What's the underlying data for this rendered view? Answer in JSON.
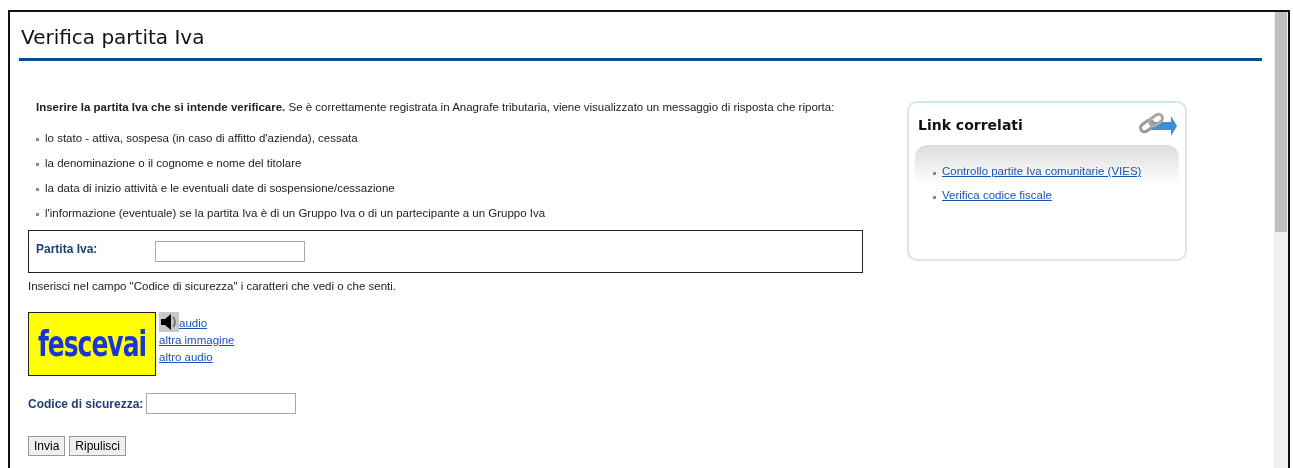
{
  "page_title": "Verifica partita Iva",
  "intro": "**Inserire la partita Iva che si intende verificare.** Se è correttamente registrata in Anagrafe tributaria, viene visualizzato un messaggio di risposta che riporta:",
  "details": [
    "lo stato - attiva, sospesa (in caso di affitto d'azienda), cessata",
    "la denominazione o il cognome e nome del titolare",
    "la data di inizio attività e le eventuali date di sospensione/cessazione",
    "l'informazione (eventuale) se la partita Iva è di un Gruppo Iva o di un partecipante a un Gruppo Iva"
  ],
  "vat_field": {
    "label": "Partita Iva:"
  },
  "captcha_hint": "Inserisci nel campo \"Codice di sicurezza\" i caratteri che vedi o che senti.",
  "captcha": {
    "text": "fescevai",
    "links": [
      "audio",
      "altra immagine",
      "altro audio"
    ]
  },
  "code_field": {
    "label": "Codice di sicurezza:"
  },
  "buttons": [
    "Invia",
    "Ripulisci"
  ],
  "related": {
    "title": "Link correlati",
    "links": [
      "Controllo partite Iva comunitarie (VIES)",
      "Verifica codice fiscale"
    ]
  }
}
